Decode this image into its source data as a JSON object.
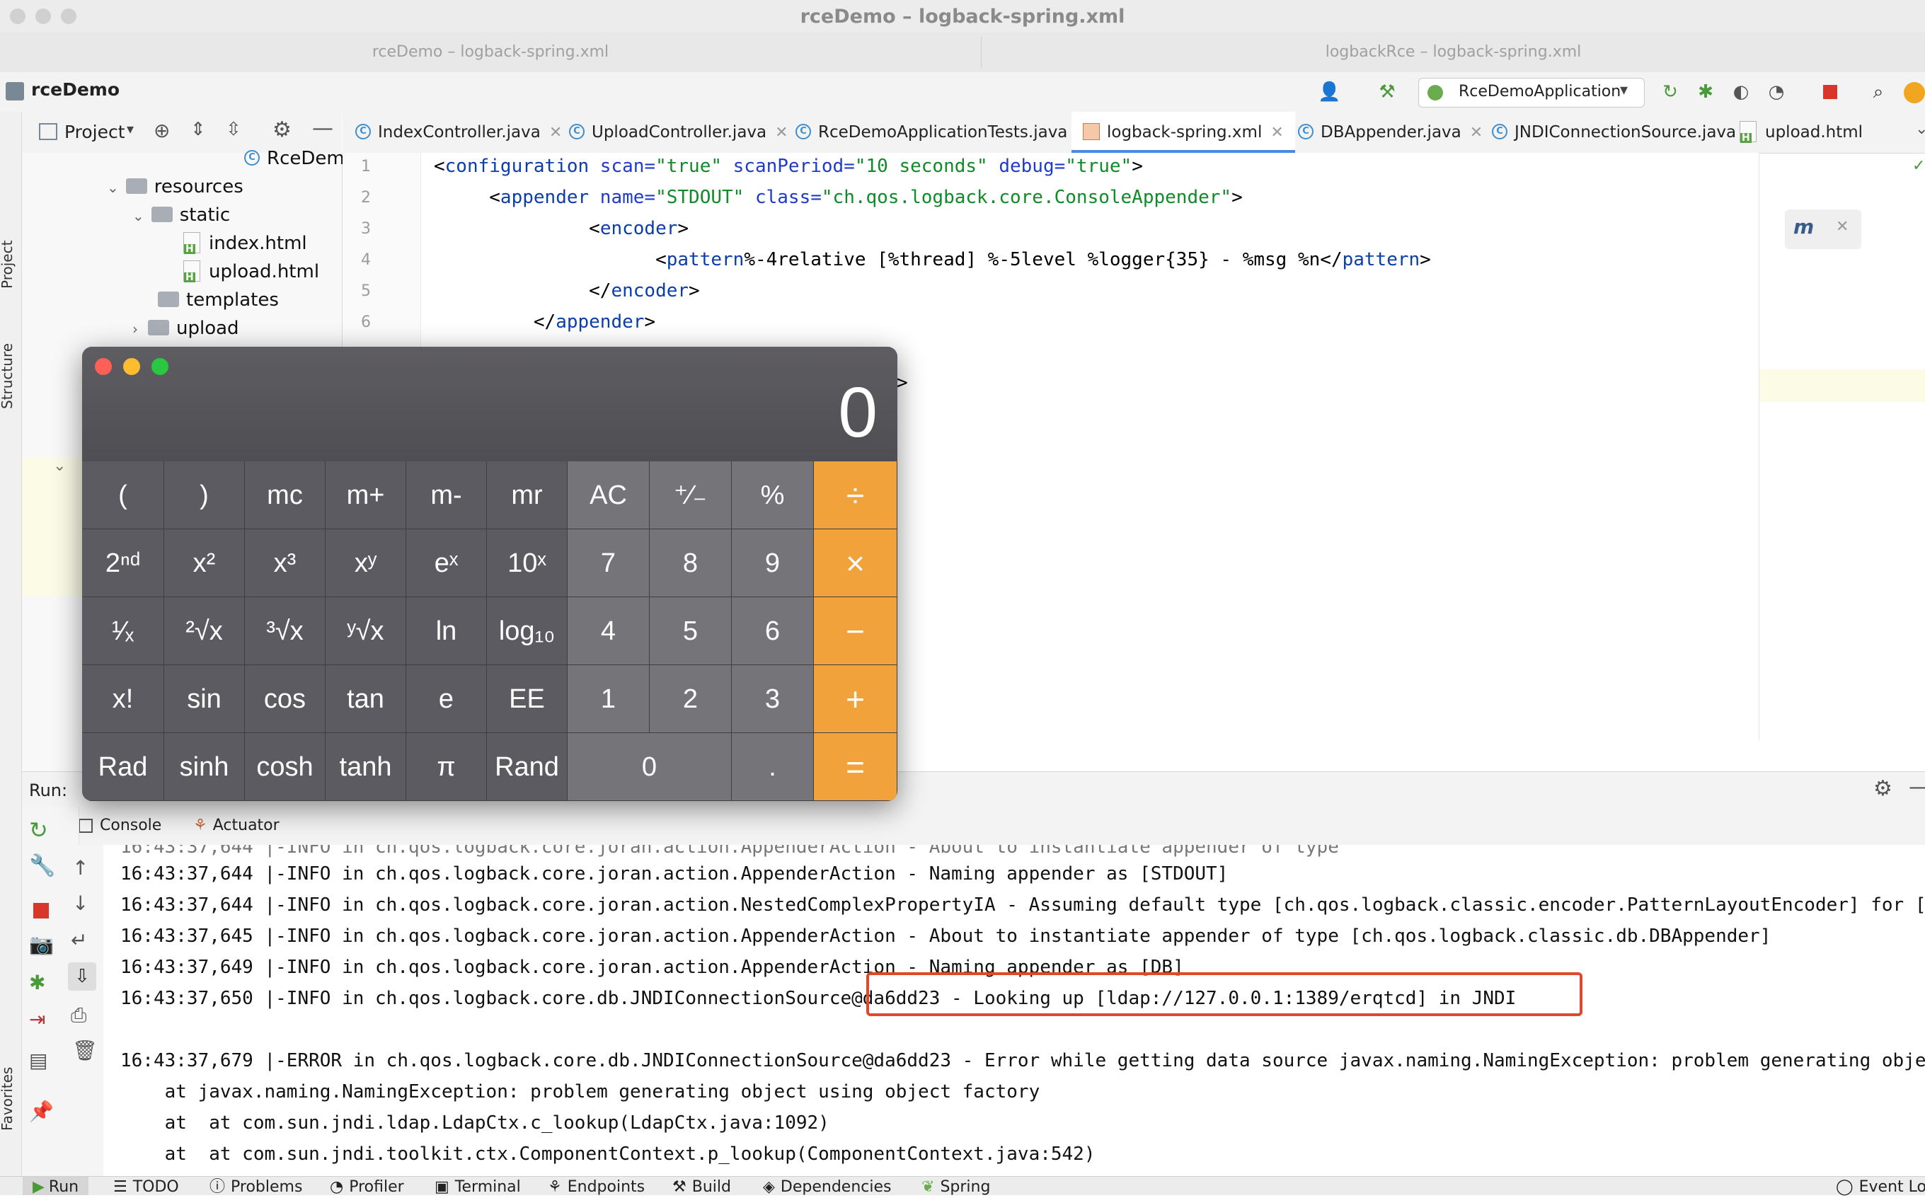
{
  "window": {
    "title": "rceDemo – logback-spring.xml",
    "tabs": [
      "rceDemo – logback-spring.xml",
      "logbackRce – logback-spring.xml"
    ]
  },
  "toolbar": {
    "project_name": "rceDemo",
    "run_config": "RceDemoApplication"
  },
  "left_stripe": {
    "project": "Project",
    "structure": "Structure",
    "favorites": "Favorites"
  },
  "project_panel": {
    "header": "Project",
    "tree": [
      {
        "label": "RceDemo",
        "kind": "class"
      },
      {
        "label": "resources",
        "kind": "folder"
      },
      {
        "label": "static",
        "kind": "folder"
      },
      {
        "label": "index.html",
        "kind": "html"
      },
      {
        "label": "upload.html",
        "kind": "html"
      },
      {
        "label": "templates",
        "kind": "folder"
      },
      {
        "label": "upload",
        "kind": "folder"
      }
    ]
  },
  "editor_tabs": [
    {
      "label": "IndexController.java"
    },
    {
      "label": "UploadController.java"
    },
    {
      "label": "RceDemoApplicationTests.java"
    },
    {
      "label": "logback-spring.xml"
    },
    {
      "label": "DBAppender.java"
    },
    {
      "label": "JNDIConnectionSource.java"
    },
    {
      "label": "upload.html"
    }
  ],
  "editor": {
    "line_numbers": [
      "1",
      "2",
      "3",
      "4",
      "5",
      "6"
    ],
    "lines": [
      {
        "pre": "<",
        "tag": "configuration",
        "a1": " scan=",
        "s1": "\"true\"",
        "a2": " scanPeriod=",
        "s2": "\"10 seconds\"",
        "a3": " debug=",
        "s3": "\"true\"",
        "post": ">"
      },
      {
        "pre": "     <",
        "tag": "appender",
        "a1": " name=",
        "s1": "\"STDOUT\"",
        "a2": " class=",
        "s2": "\"ch.qos.logback.core.ConsoleAppender\"",
        "post": ">"
      },
      {
        "pre": "              <",
        "tag": "encoder",
        "post": ">"
      },
      {
        "pre": "                    <",
        "tag": "pattern",
        "text": "%-4relative [%thread] %-5level %logger{35} - %msg %n</",
        "tag2": "pattern",
        "post": ">"
      },
      {
        "pre": "              </",
        "tag": "encoder",
        "post": ">"
      },
      {
        "pre": "         </",
        "tag": "appender",
        "post": ">"
      }
    ],
    "partial_line": ">"
  },
  "run_panel": {
    "label": "Run:",
    "tabs": [
      "Console",
      "Actuator"
    ],
    "console_lines": [
      "16:43:37,644 |-INFO in ch.qos.logback.core.joran.action.AppenderAction - Naming appender as [STDOUT]",
      "16:43:37,644 |-INFO in ch.qos.logback.core.joran.action.NestedComplexPropertyIA - Assuming default type [ch.qos.logback.classic.encoder.PatternLayoutEncoder] for [e",
      "16:43:37,645 |-INFO in ch.qos.logback.core.joran.action.AppenderAction - About to instantiate appender of type [ch.qos.logback.classic.db.DBAppender]",
      "16:43:37,649 |-INFO in ch.qos.logback.core.joran.action.AppenderAction - Naming appender as [DB]",
      "16:43:37,650 |-INFO in ch.qos.logback.core.db.JNDIConnectionSource@da6dd23 - Looking up [ldap://127.0.0.1:1389/erqtcd] in JNDI",
      "",
      "16:43:37,679 |-ERROR in ch.qos.logback.core.db.JNDIConnectionSource@da6dd23 - Error while getting data source javax.naming.NamingException: problem generating objec",
      "    at javax.naming.NamingException: problem generating object using object factory",
      "    at  at com.sun.jndi.ldap.LdapCtx.c_lookup(LdapCtx.java:1092)",
      "    at  at com.sun.jndi.toolkit.ctx.ComponentContext.p_lookup(ComponentContext.java:542)"
    ]
  },
  "bottom_tabs": [
    "Run",
    "TODO",
    "Problems",
    "Profiler",
    "Terminal",
    "Endpoints",
    "Build",
    "Dependencies",
    "Spring",
    "Event Lo"
  ],
  "calculator": {
    "display": "0",
    "rows": [
      [
        "(",
        ")",
        "mc",
        "m+",
        "m-",
        "mr",
        "AC",
        "⁺∕₋",
        "%",
        "÷"
      ],
      [
        "2ⁿᵈ",
        "x²",
        "x³",
        "xʸ",
        "eˣ",
        "10ˣ",
        "7",
        "8",
        "9",
        "×"
      ],
      [
        "¹∕ₓ",
        "²√x",
        "³√x",
        "ʸ√x",
        "ln",
        "log₁₀",
        "4",
        "5",
        "6",
        "−"
      ],
      [
        "x!",
        "sin",
        "cos",
        "tan",
        "e",
        "EE",
        "1",
        "2",
        "3",
        "+"
      ],
      [
        "Rad",
        "sinh",
        "cosh",
        "tanh",
        "π",
        "Rand",
        "0",
        ".",
        "="
      ]
    ],
    "colors": {
      "op": "#f1a23a",
      "digit": "#757479",
      "sci": "#5c5b61"
    }
  }
}
